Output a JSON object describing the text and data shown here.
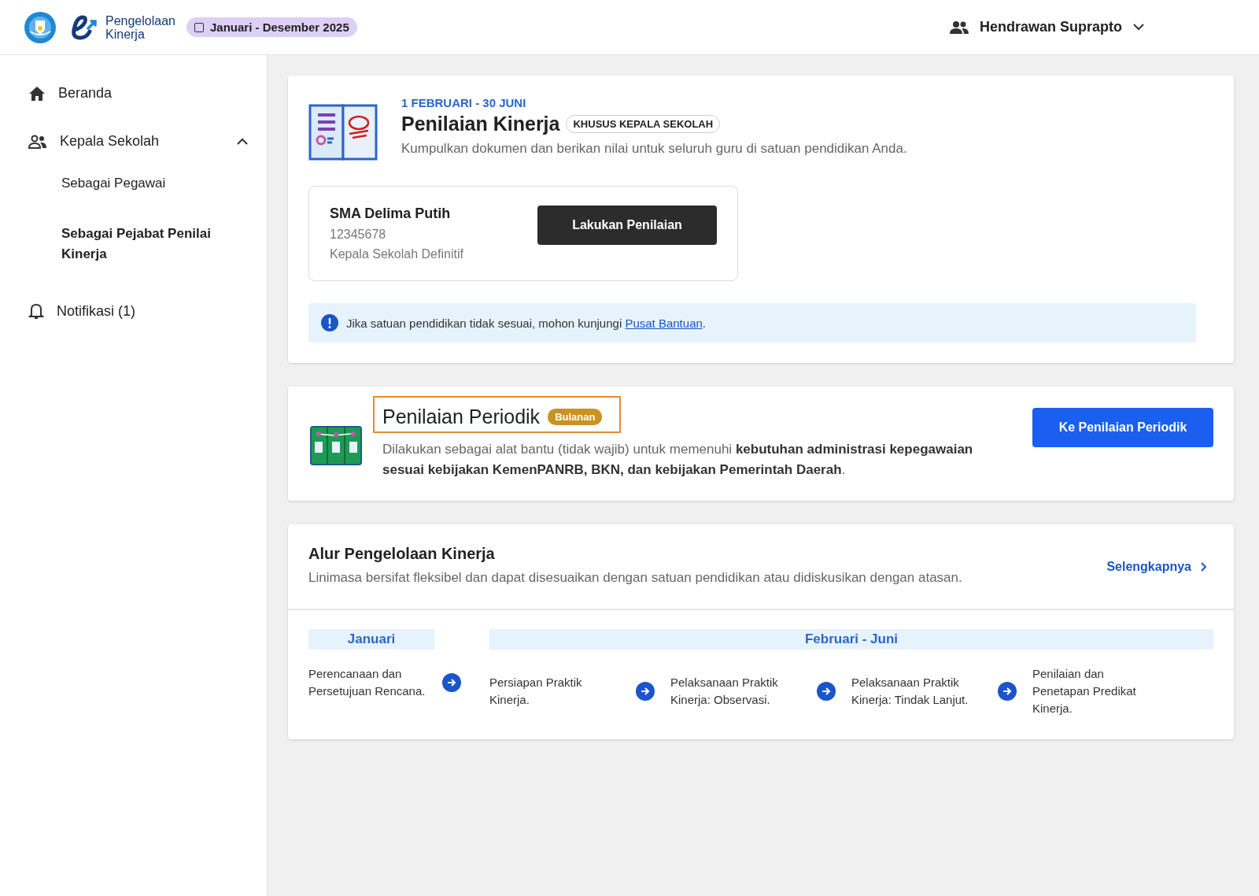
{
  "header": {
    "app_name_line1": "Pengelolaan",
    "app_name_line2": "Kinerja",
    "period": "Januari - Desember 2025",
    "user": "Hendrawan Suprapto"
  },
  "sidebar": {
    "items": [
      {
        "label": "Beranda",
        "kind": "home",
        "selected": false
      },
      {
        "label": "Kepala Sekolah",
        "kind": "people",
        "selected": false,
        "expanded": true,
        "children": [
          {
            "label": "Sebagai Pegawai",
            "selected": false
          },
          {
            "label": "Sebagai Pejabat Penilai Kinerja",
            "selected": true
          }
        ]
      },
      {
        "label": "Notifikasi (1)",
        "kind": "bell",
        "selected": false
      }
    ]
  },
  "assessment": {
    "date_range": "1 FEBRUARI - 30 JUNI",
    "title": "Penilaian Kinerja",
    "badge": "KHUSUS KEPALA SEKOLAH",
    "description": "Kumpulkan dokumen dan berikan nilai untuk seluruh guru di satuan pendidikan Anda.",
    "school": {
      "name": "SMA Delima Putih",
      "id": "12345678",
      "role": "Kepala Sekolah Definitif",
      "button": "Lakukan Penilaian"
    },
    "notice": {
      "text": "Jika satuan pendidikan tidak sesuai, mohon kunjungi ",
      "link": "Pusat Bantuan",
      "suffix": "."
    }
  },
  "periodic": {
    "title": "Penilaian Periodik",
    "highlighted": true,
    "badge": "Bulanan",
    "description": "Dilakukan sebagai alat bantu (tidak wajib) untuk memenuhi **kebutuhan administrasi kepegawaian sesuai kebijakan KemenPANRB, BKN, dan kebijakan Pemerintah Daerah**.",
    "button": "Ke Penilaian Periodik"
  },
  "flow": {
    "title": "Alur Pengelolaan Kinerja",
    "description": "Linimasa bersifat fleksibel dan dapat disesuaikan dengan satuan pendidikan atau didiskusikan dengan atasan.",
    "link": "Selengkapnya",
    "periods": [
      {
        "label": "Januari",
        "steps": [
          "Perencanaan dan Persetujuan Rencana."
        ]
      },
      {
        "label": "Februari - Juni",
        "steps": [
          "Persiapan Praktik Kinerja.",
          "Pelaksanaan Praktik Kinerja: Observasi.",
          "Pelaksanaan Praktik Kinerja: Tindak Lanjut.",
          "Penilaian dan Penetapan Predikat Kinerja."
        ]
      }
    ]
  }
}
